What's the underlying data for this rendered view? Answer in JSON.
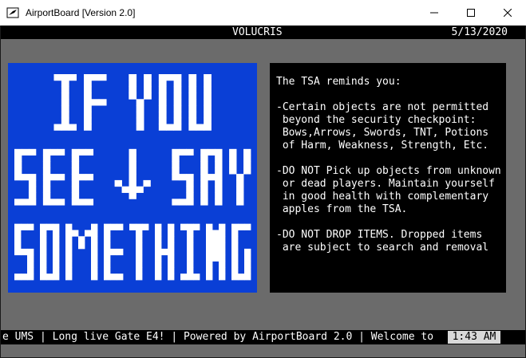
{
  "window": {
    "title": "AirportBoard [Version 2.0]"
  },
  "header": {
    "station": "VOLUCRIS",
    "date": "5/13/2020"
  },
  "poster": {
    "lines": [
      "IF YOU",
      "SEE ↓ SAY",
      "SOMETHING"
    ],
    "background": "#0a3fd6"
  },
  "notice": {
    "intro": "The TSA reminds you:",
    "items": [
      "-Certain objects are not permitted\n beyond the security checkpoint:\n Bows,Arrows, Swords, TNT, Potions\n of Harm, Weakness, Strength, Etc.",
      "-DO NOT Pick up objects from unknown\n or dead players. Maintain yourself\n in good health with complementary\n apples from the TSA.",
      "-DO NOT DROP ITEMS. Dropped items\n are subject to search and removal"
    ]
  },
  "ticker": {
    "text": "e UMS | Long live Gate E4! | Powered by AirportBoard 2.0 | Welcome to"
  },
  "clock": {
    "time": "1:43 AM"
  }
}
